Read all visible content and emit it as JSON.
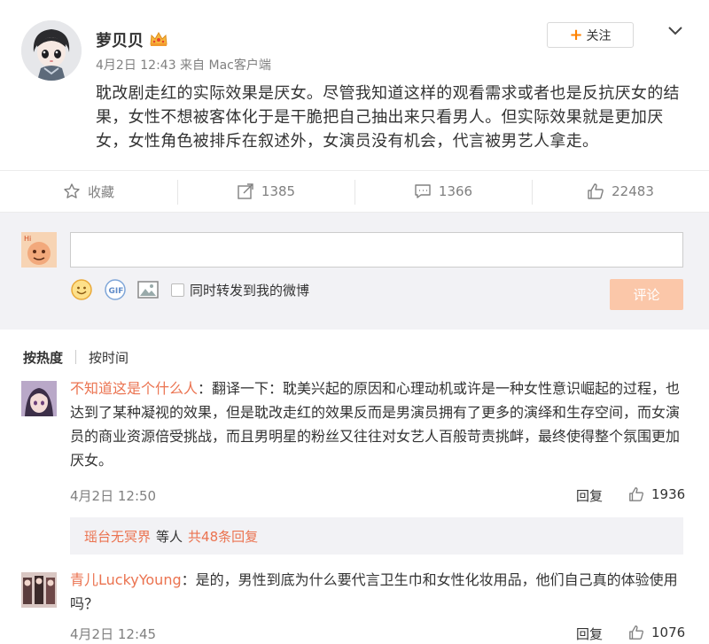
{
  "post": {
    "author": "萝贝贝",
    "meta": "4月2日 12:43 来自 Mac客户端",
    "follow_label": "关注",
    "text": "耽改剧走红的实际效果是厌女。尽管我知道这样的观看需求或者也是反抗厌女的结果，女性不想被客体化于是干脆把自己抽出来只看男人。但实际效果就是更加厌女，女性角色被排斥在叙述外，女演员没有机会，代言被男艺人拿走。"
  },
  "actions": {
    "favorite_label": "收藏",
    "repost_count": "1385",
    "comment_count": "1366",
    "like_count": "22483"
  },
  "composer": {
    "input_value": "",
    "forward_label": "同时转发到我的微博",
    "submit_label": "评论"
  },
  "sort": {
    "hot_label": "按热度",
    "time_label": "按时间"
  },
  "comments": [
    {
      "name": "不知道这是个什么人",
      "text": "：翻译一下：耽美兴起的原因和心理动机或许是一种女性意识崛起的过程，也达到了某种凝视的效果，但是耽改走红的效果反而是男演员拥有了更多的演绎和生存空间，而女演员的商业资源倍受挑战，而且男明星的粉丝又往往对女艺人百般苛责挑衅，最终使得整个氛围更加厌女。",
      "time": "4月2日 12:50",
      "reply_label": "回复",
      "likes": "1936",
      "replies": {
        "user": "瑶台无冥界",
        "middle": "等人",
        "total": "共48条回复"
      }
    },
    {
      "name": "青儿LuckyYoung",
      "text": "：是的，男性到底为什么要代言卫生巾和女性化妆用品，他们自己真的体验使用吗？",
      "time": "4月2日 12:45",
      "reply_label": "回复",
      "likes": "1076"
    }
  ],
  "colors": {
    "accent": "#ff8200",
    "name_link": "#eb7350",
    "submit_bg": "#fbc7a9",
    "composer_bg": "#f2f2f5"
  }
}
